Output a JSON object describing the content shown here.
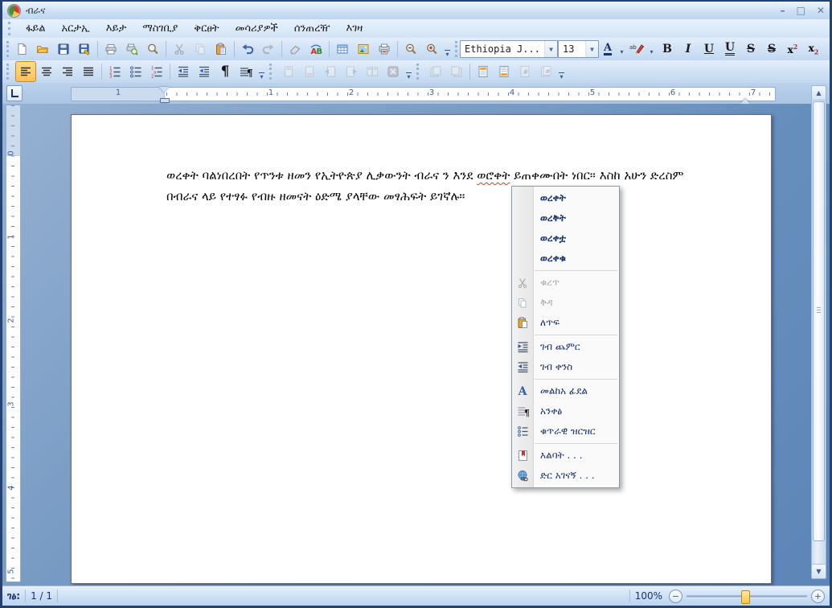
{
  "colors": {
    "window_border": "#24426f",
    "titlebar_gradient_top": "#eef5fd",
    "toolbar_bg": "#cfe1f5",
    "active_button": "#ffc254",
    "workspace_bg": "#678fbd",
    "menu_text": "#17316e",
    "spellcheck_underline": "#e03a2f"
  },
  "window": {
    "title": "ብራና",
    "minimize": "–",
    "maximize": "□",
    "close": "✕"
  },
  "menubar": {
    "items": [
      "ፋይል",
      "አርታኢ",
      "እይታ",
      "ማስገቢያ",
      "ቅርፀት",
      "መሳሪያዎች",
      "ሰንጠረዥ",
      "እገዛ"
    ]
  },
  "icons": {
    "overflow": "▾",
    "combo_arrow": "▼",
    "up_arrow": "▲",
    "down_arrow": "▼",
    "pilcrow": "¶",
    "minus": "−",
    "plus": "+",
    "hash": "#"
  },
  "toolbars": {
    "font_name": "Ethiopia J...",
    "font_size": "13",
    "font_color_letter": "A",
    "highlight_letters": "ab",
    "bold": "B",
    "italic": "I",
    "underline": "U",
    "double_underline": "U",
    "strike": "S",
    "double_strike": "S",
    "superscript_base": "x",
    "superscript_exp": "2",
    "subscript_base": "x",
    "subscript_sub": "2",
    "grow_font_letter": "A"
  },
  "ruler": {
    "margin_number": "1",
    "numbers": [
      "1",
      "2",
      "3",
      "4",
      "5",
      "6",
      "7"
    ],
    "v_zero": "0",
    "v_numbers": [
      "1",
      "2",
      "3",
      "4",
      "5"
    ]
  },
  "document": {
    "line1_before": "ወረቀት ባልነበረበት የጥንቱ ዘመን የኢትዮጵያ ሊቃውንት ብራና ን  እንደ ",
    "misspelled_word": "ወሮቀት",
    "line1_after": " ይጠቀሙበት ነበር። እስከ አሁን ድረስም",
    "line2": "በብራና ላይ የተፃፉ የብዙ ዘመናት ዕድሜ ያላቸው መፃሕፍት ይገኛሉ።"
  },
  "context_menu": {
    "suggestions": [
      "ወረቀት",
      "ወረቅት",
      "ወረቀቷ",
      "ወረቀቁ"
    ],
    "cut": "ቁረጥ",
    "copy": "ቅዳ",
    "paste": "ለጥፍ",
    "indent_more": "ገብ ጨምር",
    "indent_less": "ገብ ቀንስ",
    "font": "መልከአ ፊደል",
    "paragraph": "አንቀፅ",
    "numbered_list": "ቁጥራዊ ዝርዝር",
    "bookmark": "እልባት . . .",
    "hyperlink": "ድር አገናኝ . . ."
  },
  "status": {
    "page_label": "ገፅ:",
    "page_value": "1 / 1",
    "zoom": "100%"
  }
}
